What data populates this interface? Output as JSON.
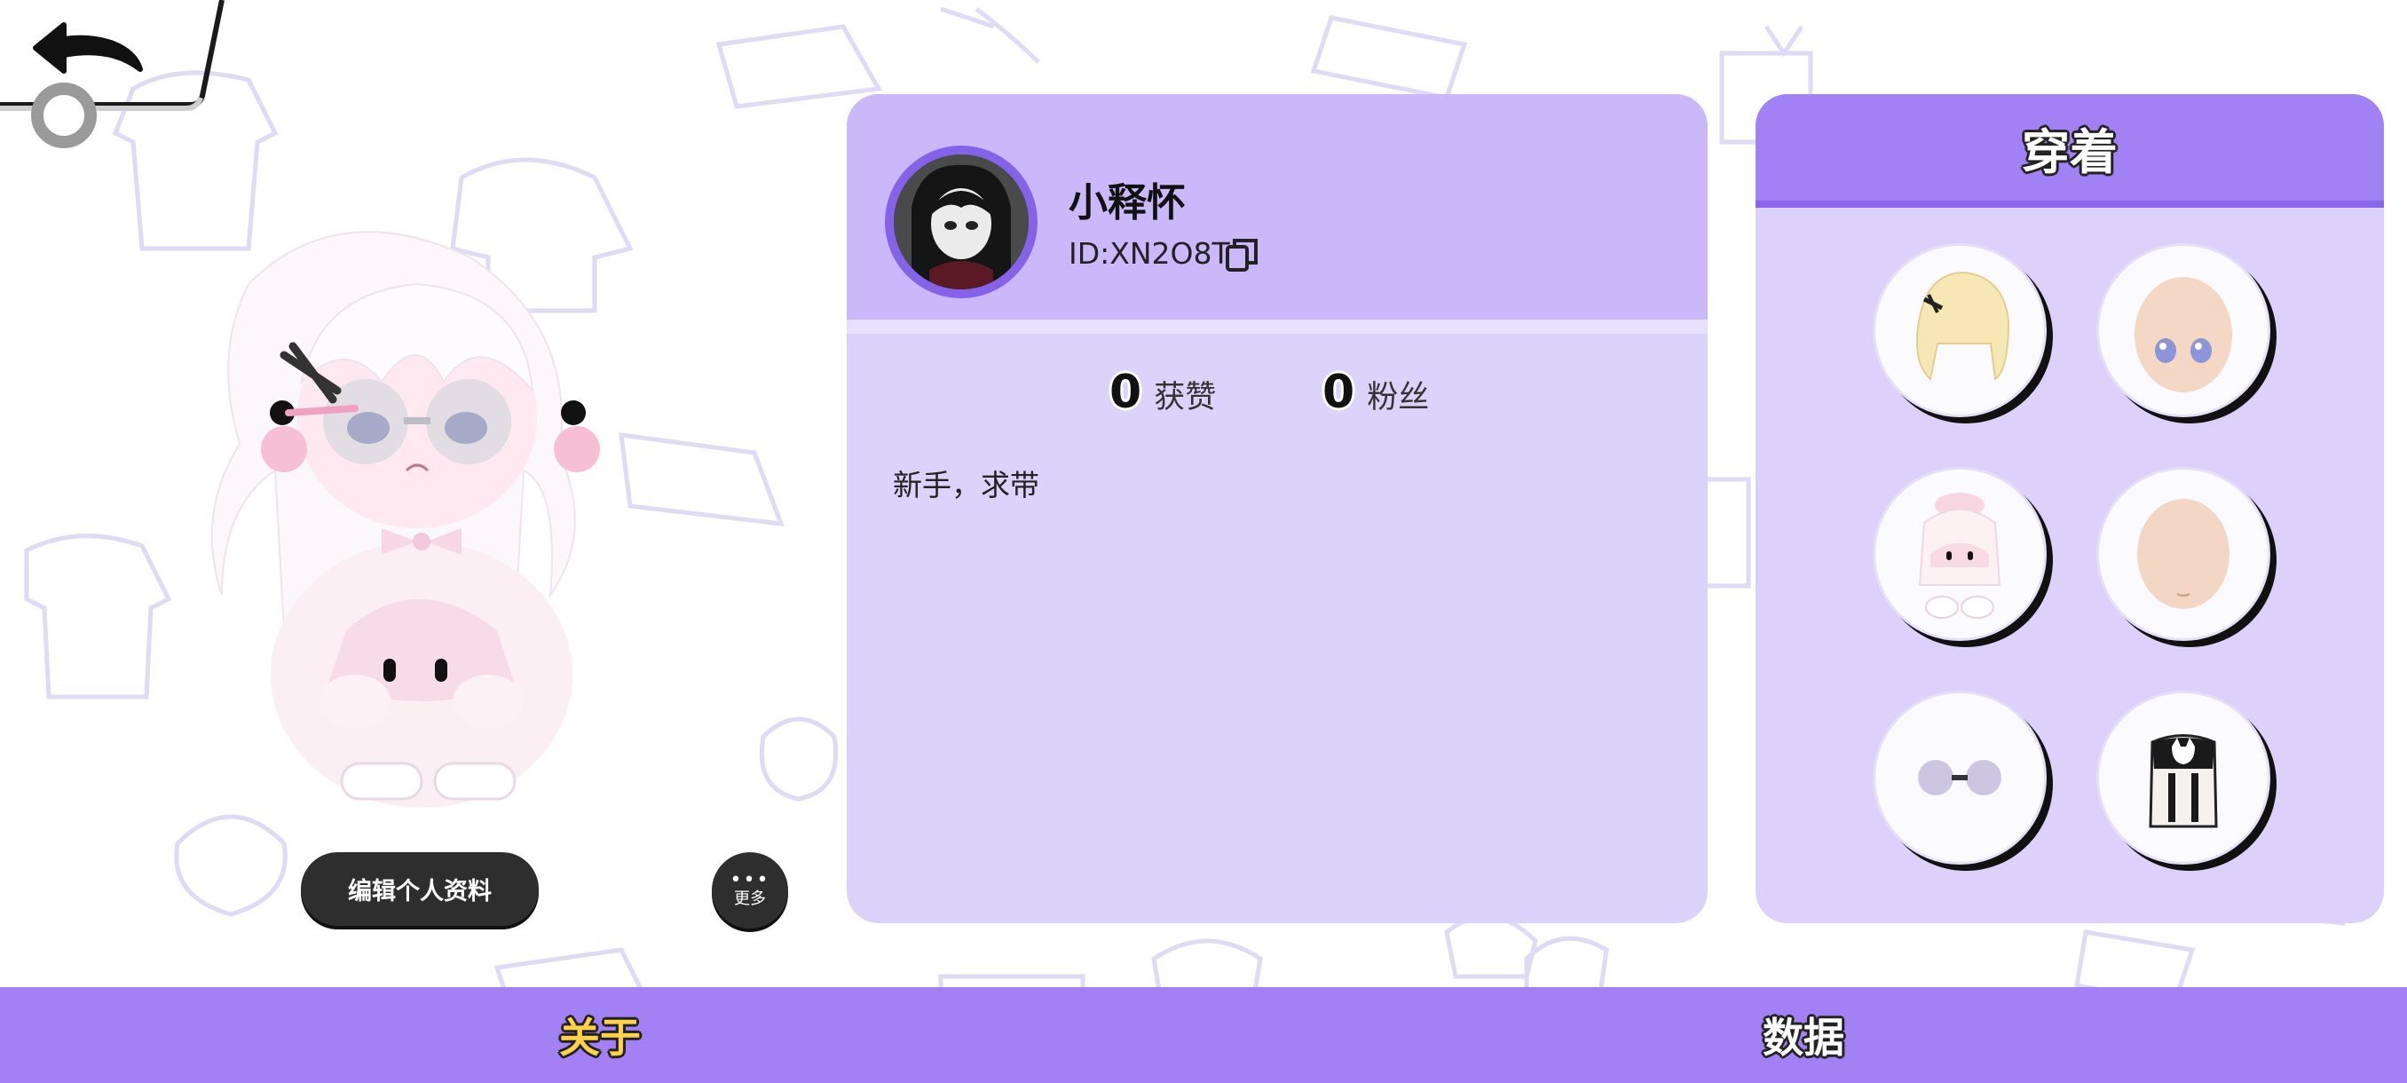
{
  "profile": {
    "username": "小释怀",
    "id_text": "ID:XN2O8T",
    "likes_count": "0",
    "likes_label": "获赞",
    "fans_count": "0",
    "fans_label": "粉丝",
    "bio": "新手，求带"
  },
  "actions": {
    "edit_profile_label": "编辑个人资料",
    "more_label": "更多",
    "more_dots": "•••"
  },
  "outfit": {
    "title": "穿着",
    "items": [
      "hair-icon",
      "eyes-face-icon",
      "outfit-costume-icon",
      "face-base-icon",
      "glasses-icon",
      "backpack-icon"
    ]
  },
  "tabs": {
    "about": "关于",
    "data": "数据"
  },
  "colors": {
    "primary": "#a181f3",
    "panel": "#dcd3fb",
    "header": "#cbb8fa",
    "active_tab": "#ffd24a"
  }
}
